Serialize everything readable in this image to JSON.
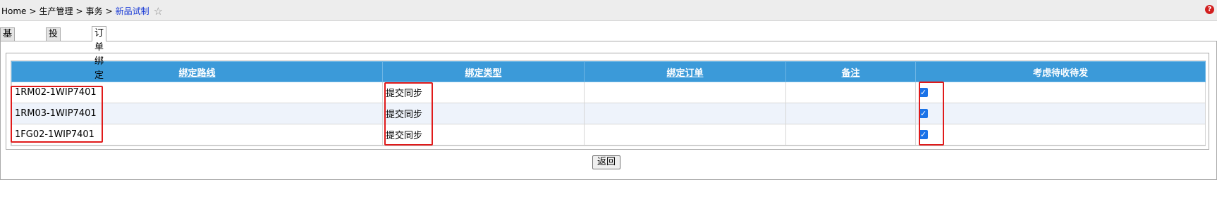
{
  "breadcrumb": {
    "items": [
      "Home",
      "生产管理",
      "事务"
    ],
    "separator": ">",
    "current": "新品试制"
  },
  "icons": {
    "favorite": "star-outline-icon",
    "help": "help-icon"
  },
  "help_label": "?",
  "tabs": [
    {
      "label": "基本信息",
      "active": false
    },
    {
      "label": "投入产出",
      "active": false
    },
    {
      "label": "订单绑定",
      "active": true
    }
  ],
  "table": {
    "headers": [
      "绑定路线",
      "绑定类型",
      "绑定订单",
      "备注",
      "考虑待收待发"
    ],
    "rows": [
      {
        "route": "1RM02-1WIP7401",
        "type": "提交同步",
        "order": "",
        "remark": "",
        "consider": true
      },
      {
        "route": "1RM03-1WIP7401",
        "type": "提交同步",
        "order": "",
        "remark": "",
        "consider": true
      },
      {
        "route": "1FG02-1WIP7401",
        "type": "提交同步",
        "order": "",
        "remark": "",
        "consider": true
      }
    ]
  },
  "back_button": "返回",
  "colors": {
    "header_bg": "#3b9ad9",
    "highlight": "#e01a1a",
    "link": "#1a3bd6",
    "checkbox": "#1a73e8"
  }
}
